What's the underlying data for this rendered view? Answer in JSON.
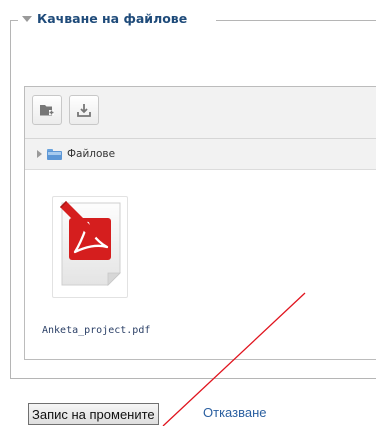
{
  "fieldset": {
    "legend": "Качване на файлове"
  },
  "filemanager": {
    "toolbar": {
      "create_folder_icon": "folder-add-icon",
      "upload_icon": "upload-icon"
    },
    "path": {
      "folder_label": "Файлове"
    },
    "files": [
      {
        "name": "Anketa_project.pdf",
        "icon": "pdf-file-icon"
      }
    ]
  },
  "actions": {
    "save_label": "Запис на промените",
    "cancel_label": "Отказване"
  },
  "colors": {
    "legend": "#1f4b7a",
    "link": "#2a5fa0",
    "pdf_red": "#d51e1e",
    "annotation_line": "#e0141e"
  }
}
